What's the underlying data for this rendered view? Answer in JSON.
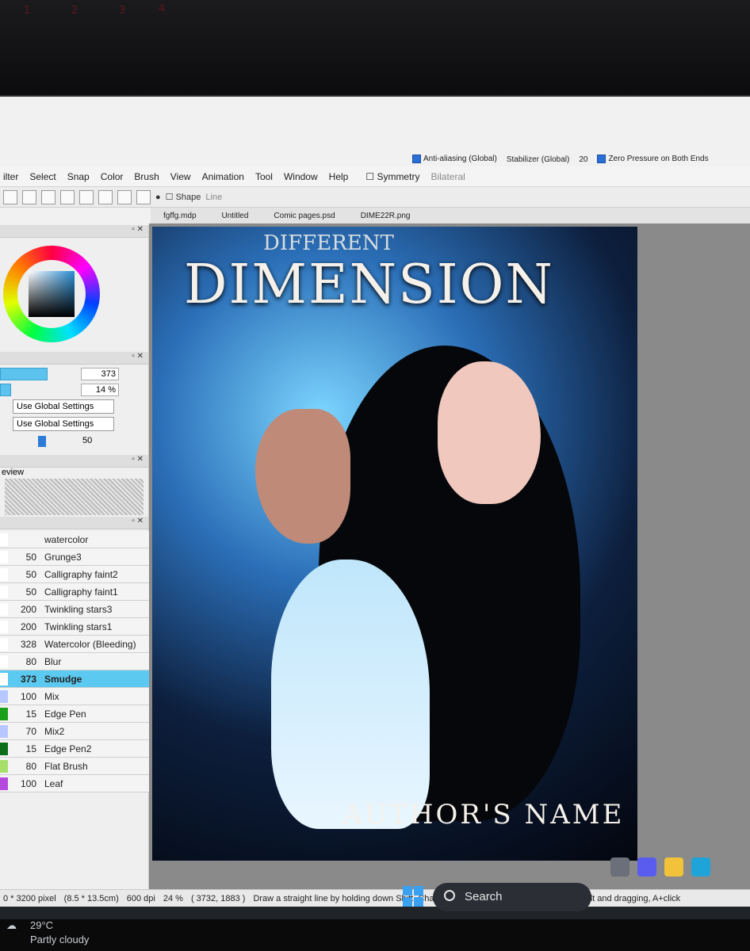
{
  "menu": [
    "ilter",
    "Select",
    "Snap",
    "Color",
    "Brush",
    "View",
    "Animation",
    "Tool",
    "Window",
    "Help"
  ],
  "top_options": {
    "antialias": "Anti-aliasing (Global)",
    "stabilizer_label": "Stabilizer (Global)",
    "stabilizer_value": "20",
    "zero_pressure": "Zero Pressure on Both Ends",
    "symmetry": "Symmetry",
    "symmetry_mode": "Bilateral",
    "shape": "Shape",
    "shape_mode": "Line"
  },
  "tabs": [
    "fgffg.mdp",
    "Untitled",
    "Comic pages.psd",
    "DIME22R.png"
  ],
  "left_panel": {
    "size_value": "373",
    "density_value": "14 %",
    "select1": "Use Global Settings",
    "select2": "Use Global Settings",
    "slider_value": "50",
    "preview_label": "eview",
    "size_fraction": 0.6,
    "density_fraction": 0.14
  },
  "brushes": [
    {
      "size": "",
      "name": "watercolor",
      "color": "#ffffff"
    },
    {
      "size": "50",
      "name": "Grunge3",
      "color": "#ffffff"
    },
    {
      "size": "50",
      "name": "Calligraphy faint2",
      "color": "#ffffff"
    },
    {
      "size": "50",
      "name": "Calligraphy faint1",
      "color": "#ffffff"
    },
    {
      "size": "200",
      "name": "Twinkling stars3",
      "color": "#ffffff"
    },
    {
      "size": "200",
      "name": "Twinkling stars1",
      "color": "#ffffff"
    },
    {
      "size": "328",
      "name": "Watercolor (Bleeding)",
      "color": "#ffffff"
    },
    {
      "size": "80",
      "name": "Blur",
      "color": "#ffffff"
    },
    {
      "size": "373",
      "name": "Smudge",
      "color": "#ffffff"
    },
    {
      "size": "100",
      "name": "Mix",
      "color": "#b6c8ff"
    },
    {
      "size": "15",
      "name": "Edge Pen",
      "color": "#1aa01a"
    },
    {
      "size": "70",
      "name": "Mix2",
      "color": "#b6c8ff"
    },
    {
      "size": "15",
      "name": "Edge Pen2",
      "color": "#0c6e1a"
    },
    {
      "size": "80",
      "name": "Flat Brush",
      "color": "#a6e06a"
    },
    {
      "size": "100",
      "name": "Leaf",
      "color": "#b54adf"
    }
  ],
  "active_brush": "Smudge",
  "cover": {
    "pre_title": "DIFFERENT",
    "title": "DIMENSION",
    "author": "AUTHOR'S NAME"
  },
  "status": {
    "pixel": "0 * 3200 pixel",
    "cm": "(8.5 * 13.5cm)",
    "dpi": "600 dpi",
    "zoom": "24 %",
    "coords": "( 3732, 1883 )",
    "hint": "Draw a straight line by holding down Shift, Change a brush size by holding down Ctrl+Alt and dragging, A+click"
  },
  "taskbar": {
    "search": "Search"
  },
  "weather": {
    "temp": "29°C",
    "desc": "Partly cloudy"
  },
  "colors": {
    "accent": "#5cc9f0",
    "win_blue": "#3aa0f0"
  }
}
